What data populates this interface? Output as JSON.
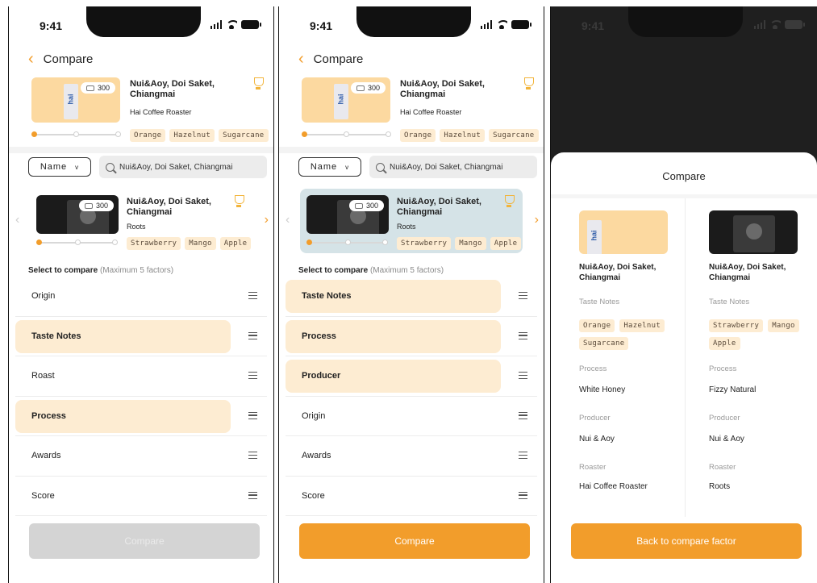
{
  "status": {
    "time": "9:41"
  },
  "header": {
    "title": "Compare"
  },
  "base": {
    "name": "Nui&Aoy, Doi Saket, Chiangmai",
    "roaster": "Hai Coffee Roaster",
    "price": "300",
    "tags": [
      "Orange",
      "Hazelnut",
      "Sugarcane"
    ]
  },
  "filter": {
    "select_value": "Name",
    "search_value": "Nui&Aoy, Doi Saket, Chiangmai"
  },
  "candidate": {
    "name": "Nui&Aoy, Doi Saket, Chiangmai",
    "roaster": "Roots",
    "price": "300",
    "tags": [
      "Strawberry",
      "Mango",
      "Apple"
    ]
  },
  "select_label": {
    "bold": "Select to compare",
    "hint": "(Maximum 5 factors)"
  },
  "screen1": {
    "factors": [
      {
        "label": "Origin",
        "selected": false
      },
      {
        "label": "Taste Notes",
        "selected": true
      },
      {
        "label": "Roast",
        "selected": false
      },
      {
        "label": "Process",
        "selected": true
      },
      {
        "label": "Awards",
        "selected": false
      },
      {
        "label": "Score",
        "selected": false
      }
    ],
    "compare_label": "Compare"
  },
  "screen2": {
    "factors": [
      {
        "label": "Taste Notes",
        "selected": true
      },
      {
        "label": "Process",
        "selected": true
      },
      {
        "label": "Producer",
        "selected": true
      },
      {
        "label": "Origin",
        "selected": false
      },
      {
        "label": "Awards",
        "selected": false
      },
      {
        "label": "Score",
        "selected": false
      }
    ],
    "compare_label": "Compare"
  },
  "screen3": {
    "title": "Compare",
    "columns": [
      {
        "name": "Nui&Aoy, Doi Saket, Chiangmai",
        "taste_label": "Taste Notes",
        "tags": [
          "Orange",
          "Hazelnut",
          "Sugarcane"
        ],
        "process_label": "Process",
        "process": "White Honey",
        "producer_label": "Producer",
        "producer": "Nui & Aoy",
        "roaster_label": "Roaster",
        "roaster": "Hai Coffee Roaster"
      },
      {
        "name": "Nui&Aoy, Doi Saket, Chiangmai",
        "taste_label": "Taste Notes",
        "tags": [
          "Strawberry",
          "Mango",
          "Apple"
        ],
        "process_label": "Process",
        "process": "Fizzy Natural",
        "producer_label": "Producer",
        "producer": "Nui & Aoy",
        "roaster_label": "Roaster",
        "roaster": "Roots"
      }
    ],
    "back_label": "Back to compare factor"
  },
  "colors": {
    "accent": "#f29d2b",
    "selected_bg": "#fdecd2",
    "card_selected": "#d5e3e7",
    "disabled": "#d4d4d4"
  }
}
